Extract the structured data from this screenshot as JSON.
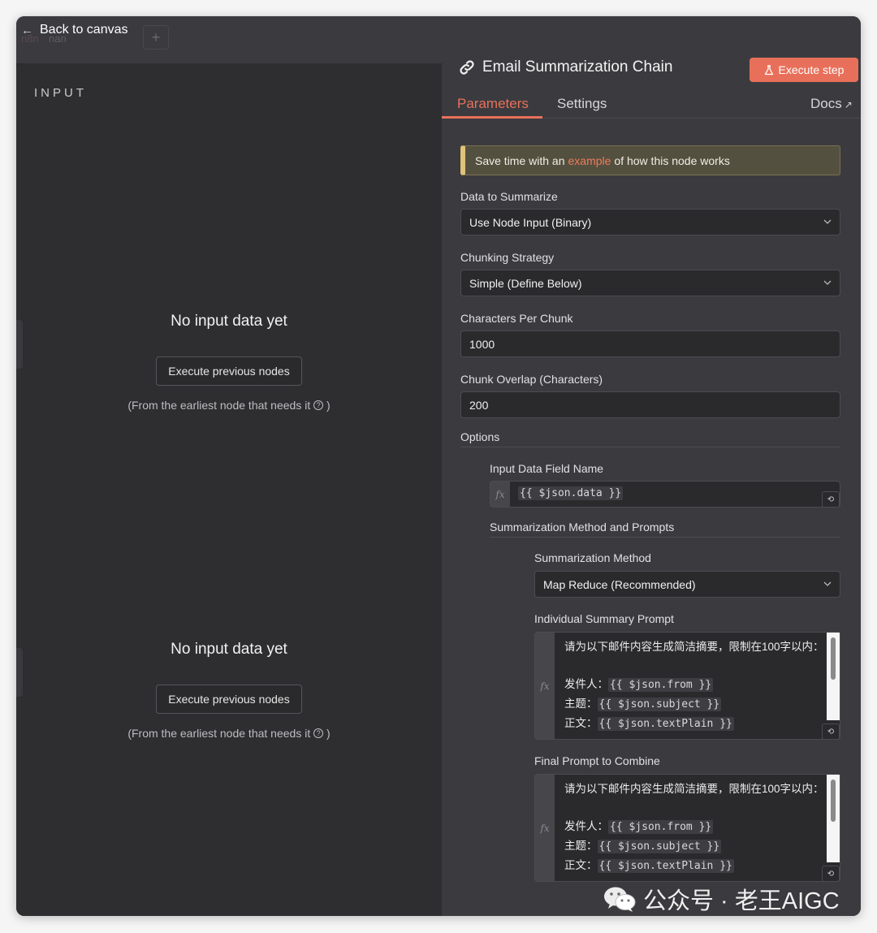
{
  "topbar": {
    "back_label": "Back to canvas",
    "ghost_logo": "n8n",
    "ghost_name": "nan",
    "add_label": "+"
  },
  "input_panel": {
    "title": "INPUT",
    "empty_states": [
      {
        "title": "No input data yet",
        "button": "Execute previous nodes",
        "hint": "(From the earliest node that needs it",
        "hint_close": ")"
      },
      {
        "title": "No input data yet",
        "button": "Execute previous nodes",
        "hint": "(From the earliest node that needs it",
        "hint_close": ")"
      }
    ]
  },
  "node": {
    "title": "Email Summarization Chain",
    "execute_label": "Execute step",
    "tabs": {
      "parameters": "Parameters",
      "settings": "Settings",
      "docs": "Docs"
    },
    "notice": {
      "before": "Save time with an",
      "link": "example",
      "after": "of how this node works"
    },
    "fields": {
      "data_to_summarize": {
        "label": "Data to Summarize",
        "value": "Use Node Input (Binary)"
      },
      "chunking_strategy": {
        "label": "Chunking Strategy",
        "value": "Simple (Define Below)"
      },
      "chars_per_chunk": {
        "label": "Characters Per Chunk",
        "value": "1000"
      },
      "chunk_overlap": {
        "label": "Chunk Overlap (Characters)",
        "value": "200"
      }
    },
    "options": {
      "label": "Options",
      "input_field_name": {
        "label": "Input Data Field Name",
        "value": "{{ $json.data }}"
      },
      "method_section": "Summarization Method and Prompts",
      "method": {
        "label": "Summarization Method",
        "value": "Map Reduce (Recommended)"
      },
      "individual_prompt": {
        "label": "Individual Summary Prompt",
        "intro": "请为以下邮件内容生成简洁摘要，限制在100字以内：",
        "from_label": "发件人：",
        "from_expr": "{{ $json.from }}",
        "subject_label": "主题：",
        "subject_expr": "{{ $json.subject }}",
        "body_label": "正文：",
        "body_expr": "{{ $json.textPlain }}"
      },
      "final_prompt": {
        "label": "Final Prompt to Combine",
        "intro": "请为以下邮件内容生成简洁摘要，限制在100字以内：",
        "from_label": "发件人：",
        "from_expr": "{{ $json.from }}",
        "subject_label": "主题：",
        "subject_expr": "{{ $json.subject }}",
        "body_label": "正文：",
        "body_expr": "{{ $json.textPlain }}"
      }
    },
    "fx_label": "fx"
  },
  "watermark": {
    "text": "公众号 · 老王AIGC"
  },
  "colors": {
    "accent": "#e8705a",
    "panel": "#3b3b3f",
    "input_bg": "#2a2a2d",
    "notice_border": "#e0c27a"
  }
}
